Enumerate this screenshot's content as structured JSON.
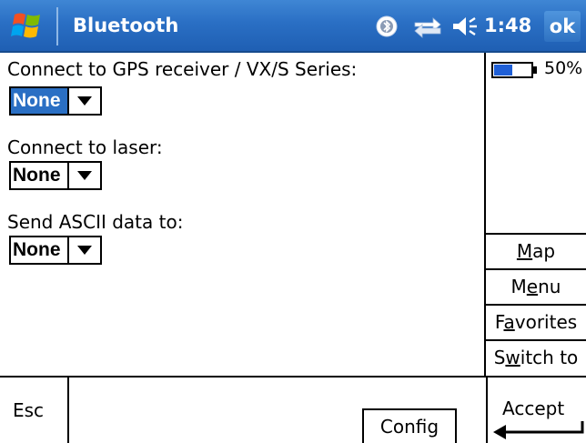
{
  "titlebar": {
    "title": "Bluetooth",
    "clock": "1:48",
    "ok_label": "ok",
    "icons": [
      "windows-start-icon",
      "bluetooth-status-icon",
      "connectivity-icon",
      "volume-icon"
    ]
  },
  "form": {
    "gps_label": "Connect to GPS receiver / VX/S Series:",
    "gps_value": "None",
    "laser_label": "Connect to laser:",
    "laser_value": "None",
    "ascii_label": "Send ASCII data to:",
    "ascii_value": "None"
  },
  "battery": {
    "percent_label": "50%",
    "level": 0.5
  },
  "side_menu": {
    "map_pre": "",
    "map_ul": "M",
    "map_post": "ap",
    "menu_pre": "M",
    "menu_ul": "e",
    "menu_post": "nu",
    "favorites_pre": "F",
    "favorites_ul": "a",
    "favorites_post": "vorites",
    "switch_pre": "S",
    "switch_ul": "w",
    "switch_post": "itch to"
  },
  "bottom": {
    "esc_label": "Esc",
    "config_label": "Config",
    "accept_label": "Accept"
  },
  "colors": {
    "titlebar": "#2a6fc4",
    "selection": "#2a6fc4",
    "battery_fill": "#1f5fd6"
  }
}
